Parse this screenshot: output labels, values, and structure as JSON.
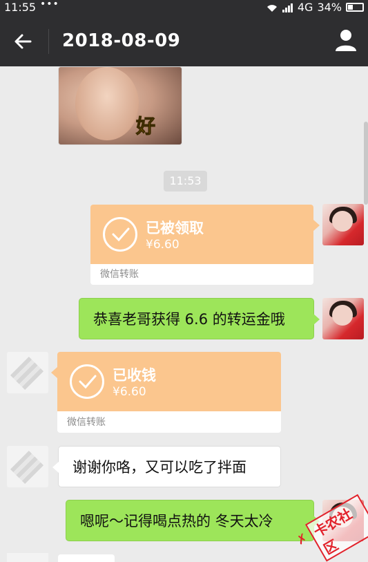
{
  "status": {
    "time": "11:55",
    "dots": "•••",
    "network": "4G",
    "battery": "34%"
  },
  "nav": {
    "title": "2018-08-09"
  },
  "sticker": {
    "text": "好"
  },
  "timestamp": "11:53",
  "messages": {
    "transfer_sent": {
      "status": "已被领取",
      "amount": "¥6.60",
      "label": "微信转账"
    },
    "text_sent_1": "恭喜老哥获得 6.6 的转运金哦",
    "transfer_received": {
      "status": "已收钱",
      "amount": "¥6.60",
      "label": "微信转账"
    },
    "text_received_1": "谢谢你咯，又可以吃了拌面",
    "text_sent_2": "嗯呢～记得喝点热的  冬天太冷"
  },
  "watermark": {
    "text": "卡农社区"
  },
  "colors": {
    "bar": "#2e2e30",
    "background": "#ebebeb",
    "green_bubble": "#9de55a",
    "transfer": "#fbc68e"
  }
}
